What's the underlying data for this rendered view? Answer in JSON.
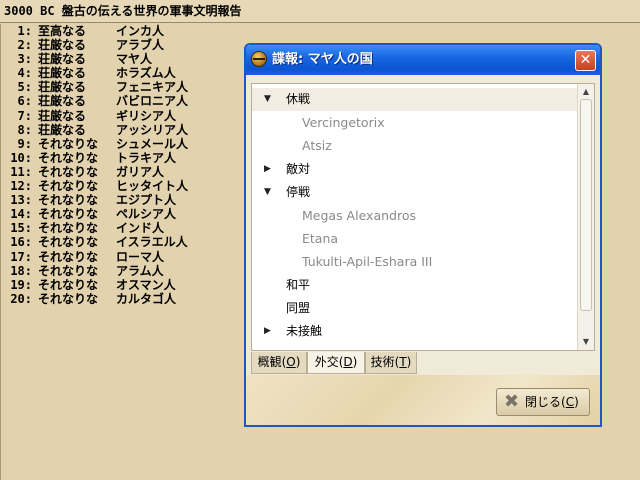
{
  "report": {
    "header": "3000 BC 盤古の伝える世界の軍事文明報告",
    "rows": [
      {
        "rank": "1:",
        "title": "至高なる",
        "civ": "インカ人"
      },
      {
        "rank": "2:",
        "title": "荘厳なる",
        "civ": "アラブ人"
      },
      {
        "rank": "3:",
        "title": "荘厳なる",
        "civ": "マヤ人"
      },
      {
        "rank": "4:",
        "title": "荘厳なる",
        "civ": "ホラズム人"
      },
      {
        "rank": "5:",
        "title": "荘厳なる",
        "civ": "フェニキア人"
      },
      {
        "rank": "6:",
        "title": "荘厳なる",
        "civ": "バビロニア人"
      },
      {
        "rank": "7:",
        "title": "荘厳なる",
        "civ": "ギリシア人"
      },
      {
        "rank": "8:",
        "title": "荘厳なる",
        "civ": "アッシリア人"
      },
      {
        "rank": "9:",
        "title": "それなりな",
        "civ": "シュメール人"
      },
      {
        "rank": "10:",
        "title": "それなりな",
        "civ": "トラキア人"
      },
      {
        "rank": "11:",
        "title": "それなりな",
        "civ": "ガリア人"
      },
      {
        "rank": "12:",
        "title": "それなりな",
        "civ": "ヒッタイト人"
      },
      {
        "rank": "13:",
        "title": "それなりな",
        "civ": "エジプト人"
      },
      {
        "rank": "14:",
        "title": "それなりな",
        "civ": "ペルシア人"
      },
      {
        "rank": "15:",
        "title": "それなりな",
        "civ": "インド人"
      },
      {
        "rank": "16:",
        "title": "それなりな",
        "civ": "イスラエル人"
      },
      {
        "rank": "17:",
        "title": "それなりな",
        "civ": "ローマ人"
      },
      {
        "rank": "18:",
        "title": "それなりな",
        "civ": "アラム人"
      },
      {
        "rank": "19:",
        "title": "それなりな",
        "civ": "オスマン人"
      },
      {
        "rank": "20:",
        "title": "それなりな",
        "civ": "カルタゴ人"
      }
    ]
  },
  "dialog": {
    "title": "諜報: マヤ人の国",
    "close_glyph": "✕",
    "tree": [
      {
        "label": "休戦",
        "kind": "category",
        "expanded": true,
        "selected": true
      },
      {
        "label": "Vercingetorix",
        "kind": "leaf"
      },
      {
        "label": "Atsiz",
        "kind": "leaf"
      },
      {
        "label": "敵対",
        "kind": "category",
        "expanded": false
      },
      {
        "label": "停戦",
        "kind": "category",
        "expanded": true
      },
      {
        "label": "Megas Alexandros",
        "kind": "leaf"
      },
      {
        "label": "Etana",
        "kind": "leaf"
      },
      {
        "label": "Tukulti-Apil-Eshara III",
        "kind": "leaf"
      },
      {
        "label": "和平",
        "kind": "category",
        "expanded": false,
        "no_arrow": true
      },
      {
        "label": "同盟",
        "kind": "category",
        "expanded": false,
        "no_arrow": true
      },
      {
        "label": "未接触",
        "kind": "category",
        "expanded": false
      }
    ],
    "tabs": [
      {
        "label": "概観",
        "key": "O"
      },
      {
        "label": "外交",
        "key": "D",
        "active": true
      },
      {
        "label": "技術",
        "key": "T"
      }
    ],
    "close_button": {
      "label": "閉じる",
      "key": "C"
    }
  },
  "colors": {
    "background": "#e2d2ad",
    "titlebar": "#0b55d4",
    "close_button": "#c7401f"
  },
  "icons": {
    "title_icon": "globe-icon",
    "close": "close-icon",
    "expand": "triangle-down-icon",
    "collapse": "triangle-right-icon",
    "close_dialog": "x-mark-icon"
  }
}
